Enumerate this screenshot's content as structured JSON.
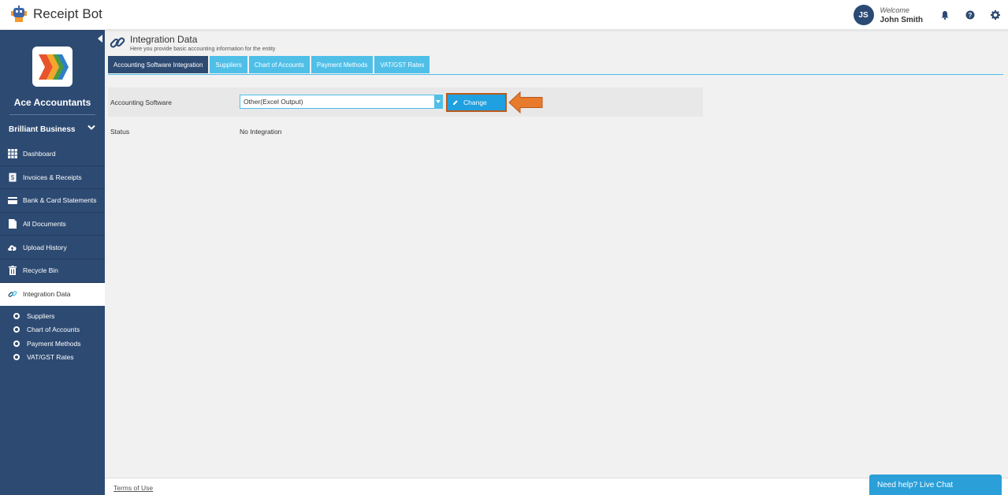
{
  "app": {
    "name": "Receipt Bot"
  },
  "user": {
    "initials": "JS",
    "welcome": "Welcome",
    "name": "John Smith"
  },
  "sidebar": {
    "company": "Ace Accountants",
    "entity": "Brilliant Business",
    "items": [
      {
        "label": "Dashboard",
        "icon": "grid-icon"
      },
      {
        "label": "Invoices & Receipts",
        "icon": "receipt-icon"
      },
      {
        "label": "Bank & Card Statements",
        "icon": "card-icon"
      },
      {
        "label": "All Documents",
        "icon": "document-icon"
      },
      {
        "label": "Upload History",
        "icon": "cloud-upload-icon"
      },
      {
        "label": "Recycle Bin",
        "icon": "trash-icon"
      },
      {
        "label": "Integration Data",
        "icon": "link-icon"
      }
    ],
    "subitems": [
      "Suppliers",
      "Chart of Accounts",
      "Payment Methods",
      "VAT/GST Rates"
    ]
  },
  "page": {
    "title": "Integration Data",
    "subtitle": "Here you provide basic accounting information for the entity"
  },
  "tabs": [
    {
      "label": "Accounting Software Integration"
    },
    {
      "label": "Suppliers"
    },
    {
      "label": "Chart of Accounts"
    },
    {
      "label": "Payment Methods"
    },
    {
      "label": "VAT/GST Rates"
    }
  ],
  "form": {
    "software_label": "Accounting Software",
    "software_value": "Other(Excel Output)",
    "change_label": "Change",
    "status_label": "Status",
    "status_value": "No Integration"
  },
  "footer": {
    "terms": "Terms of Use"
  },
  "chat": {
    "label": "Need help? Live Chat"
  },
  "colors": {
    "navy": "#2d4a72",
    "accent": "#4fbfe8",
    "button": "#1fa0e0",
    "annotation": "#e87a2c"
  }
}
